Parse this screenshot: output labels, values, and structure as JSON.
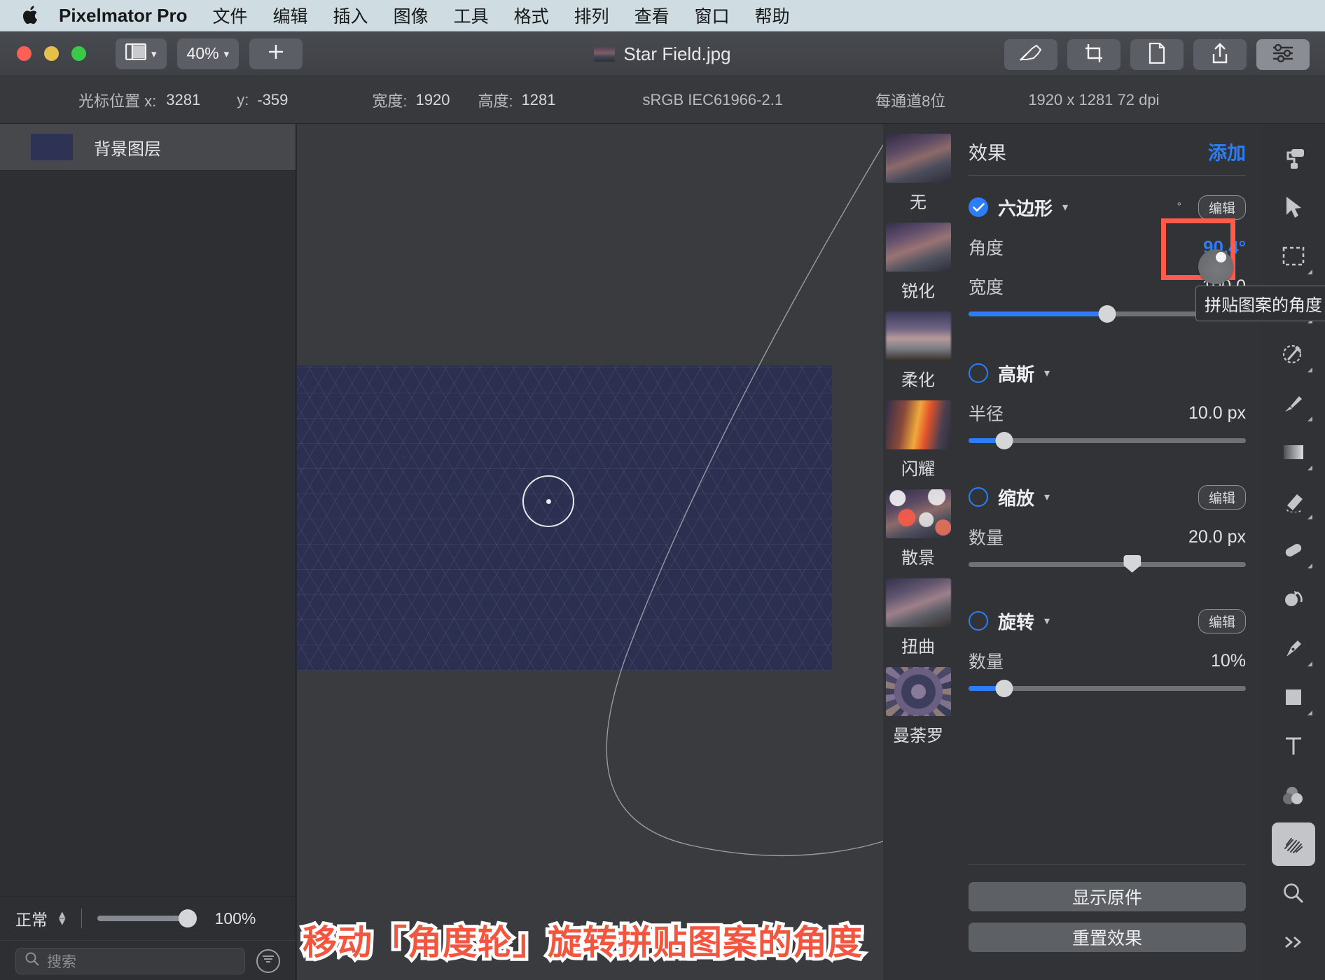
{
  "menubar": {
    "app_name": "Pixelmator Pro",
    "apple_icon": "apple-logo-icon",
    "items": [
      "文件",
      "编辑",
      "插入",
      "图像",
      "工具",
      "格式",
      "排列",
      "查看",
      "窗口",
      "帮助"
    ]
  },
  "titlebar": {
    "zoom_level": "40%",
    "add_label": "+",
    "document_name": "Star Field.jpg",
    "layout_icon": "panel-layout-icon",
    "right_tools": [
      "retouch-icon",
      "crop-icon",
      "document-icon",
      "share-icon",
      "inspector-icon"
    ]
  },
  "infobar": {
    "cursor_label": "光标位置 x:",
    "cursor_x": "3281",
    "cursor_y_label": "y:",
    "cursor_y": "-359",
    "width_label": "宽度:",
    "width_value": "1920",
    "height_label": "高度:",
    "height_value": "1281",
    "colorspace": "sRGB IEC61966-2.1",
    "bitdepth": "每通道8位",
    "dimensions": "1920 x 1281 72 dpi"
  },
  "layers": {
    "rows": [
      {
        "name": "背景图层"
      }
    ],
    "blend_mode": "正常",
    "opacity": "100%",
    "search_placeholder": "搜索"
  },
  "canvas": {
    "annotation": "移动「角度轮」旋转拼贴图案的角度",
    "annotation_color": "#f4553f"
  },
  "effects_strip": {
    "items": [
      {
        "label": "无",
        "thumb": "th-none"
      },
      {
        "label": "锐化",
        "thumb": "th-sharp"
      },
      {
        "label": "柔化",
        "thumb": "th-soft"
      },
      {
        "label": "闪耀",
        "thumb": "th-glow"
      },
      {
        "label": "散景",
        "thumb": "th-bokeh"
      },
      {
        "label": "扭曲",
        "thumb": "th-distort"
      },
      {
        "label": "曼荼罗",
        "thumb": "th-mandala"
      }
    ]
  },
  "inspector": {
    "title": "效果",
    "add_label": "添加",
    "tooltip": "拼贴图案的角度",
    "edit_label": "编辑",
    "degree_mark": "°",
    "sections": [
      {
        "name": "六边形",
        "enabled": true,
        "has_edit": true,
        "has_angle_wheel": true,
        "params": [
          {
            "label": "角度",
            "value": "90.4°",
            "accent": true,
            "slider": null
          },
          {
            "label": "宽度",
            "value": "100.0",
            "accent": false,
            "slider": {
              "pct": 50,
              "style": "round"
            }
          }
        ]
      },
      {
        "name": "高斯",
        "enabled": false,
        "has_edit": false,
        "has_angle_wheel": false,
        "params": [
          {
            "label": "半径",
            "value": "10.0 px",
            "accent": false,
            "slider": {
              "pct": 13,
              "style": "round"
            }
          }
        ]
      },
      {
        "name": "缩放",
        "enabled": false,
        "has_edit": true,
        "has_angle_wheel": false,
        "params": [
          {
            "label": "数量",
            "value": "20.0 px",
            "accent": false,
            "slider": {
              "pct": 59,
              "style": "pointer"
            }
          }
        ]
      },
      {
        "name": "旋转",
        "enabled": false,
        "has_edit": true,
        "has_angle_wheel": false,
        "params": [
          {
            "label": "数量",
            "value": "10%",
            "accent": false,
            "slider": {
              "pct": 13,
              "style": "round"
            }
          }
        ]
      }
    ],
    "show_original_label": "显示原件",
    "reset_label": "重置效果"
  },
  "toolrail": {
    "tools": [
      {
        "icon": "paint-roller-icon",
        "selected": false,
        "submenu": false
      },
      {
        "icon": "arrow-select-icon",
        "selected": false,
        "submenu": false
      },
      {
        "icon": "rect-marquee-icon",
        "selected": false,
        "submenu": true
      },
      {
        "icon": "magic-wand-icon",
        "selected": false,
        "submenu": true
      },
      {
        "icon": "quick-select-icon",
        "selected": false,
        "submenu": true
      },
      {
        "icon": "paintbrush-icon",
        "selected": false,
        "submenu": true
      },
      {
        "icon": "gradient-icon",
        "selected": false,
        "submenu": true
      },
      {
        "icon": "eraser-icon",
        "selected": false,
        "submenu": true
      },
      {
        "icon": "repair-icon",
        "selected": false,
        "submenu": true
      },
      {
        "icon": "clone-stamp-icon",
        "selected": false,
        "submenu": false
      },
      {
        "icon": "pen-icon",
        "selected": false,
        "submenu": true
      },
      {
        "icon": "shape-square-icon",
        "selected": false,
        "submenu": true
      },
      {
        "icon": "text-tool-icon",
        "selected": false,
        "submenu": false
      },
      {
        "icon": "color-adjust-icon",
        "selected": false,
        "submenu": false
      },
      {
        "icon": "effects-brush-icon",
        "selected": true,
        "submenu": false
      },
      {
        "icon": "zoom-magnifier-icon",
        "selected": false,
        "submenu": false
      },
      {
        "icon": "more-chevrons-icon",
        "selected": false,
        "submenu": false
      }
    ]
  }
}
